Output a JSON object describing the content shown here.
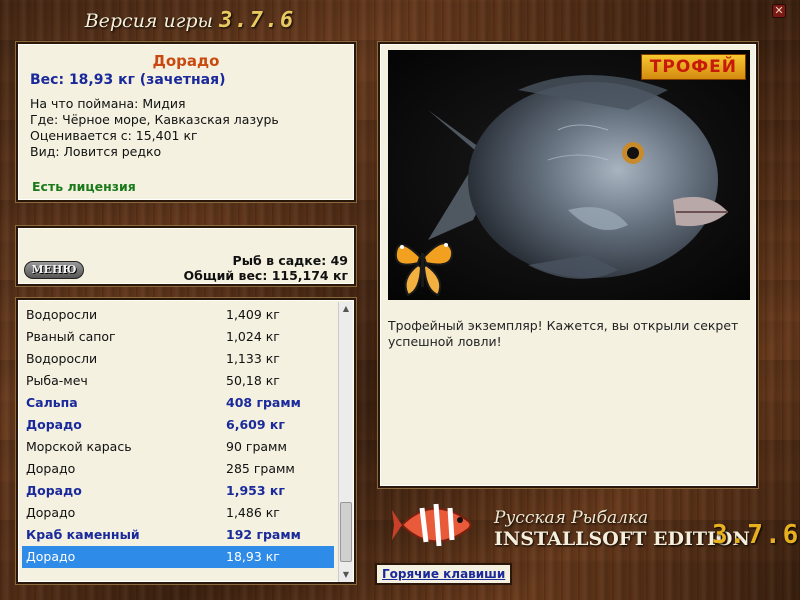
{
  "header": {
    "title": "Версия игры",
    "version": "3.7.6"
  },
  "catch_info": {
    "fish_name": "Дорадо",
    "weight_line": "Вес: 18,93 кг (зачетная)",
    "lines": [
      "На что поймана: Мидия",
      "Где: Чёрное море, Кавказская лазурь",
      "Оценивается с: 15,401 кг",
      "Вид: Ловится редко"
    ],
    "license": "Есть лицензия"
  },
  "menu": {
    "label": "МЕНЮ"
  },
  "stats": {
    "fish_in_keepnet": "Рыб в садке: 49",
    "total_weight": "Общий вес: 115,174 кг"
  },
  "catch_list": [
    {
      "name": "Водоросли",
      "weight": "1,409 кг",
      "bold": false,
      "selected": false
    },
    {
      "name": "Рваный сапог",
      "weight": "1,024 кг",
      "bold": false,
      "selected": false
    },
    {
      "name": "Водоросли",
      "weight": "1,133 кг",
      "bold": false,
      "selected": false
    },
    {
      "name": "Рыба-меч",
      "weight": "50,18 кг",
      "bold": false,
      "selected": false
    },
    {
      "name": "Сальпа",
      "weight": "408 грамм",
      "bold": true,
      "selected": false
    },
    {
      "name": "Дорадо",
      "weight": "6,609 кг",
      "bold": true,
      "selected": false
    },
    {
      "name": "Морской карась",
      "weight": "90 грамм",
      "bold": false,
      "selected": false
    },
    {
      "name": "Дорадо",
      "weight": "285 грамм",
      "bold": false,
      "selected": false
    },
    {
      "name": "Дорадо",
      "weight": "1,953 кг",
      "bold": true,
      "selected": false
    },
    {
      "name": "Дорадо",
      "weight": "1,486 кг",
      "bold": false,
      "selected": false
    },
    {
      "name": "Краб каменный",
      "weight": "192 грамм",
      "bold": true,
      "selected": false
    },
    {
      "name": "Дорадо",
      "weight": "18,93 кг",
      "bold": false,
      "selected": true
    }
  ],
  "photo": {
    "badge": "ТРОФЕЙ",
    "caption": "Трофейный экземпляр! Кажется, вы открыли секрет успешной ловли!"
  },
  "hotkeys": {
    "label": "Горячие клавиши"
  },
  "brand": {
    "title": "Русская Рыбалка",
    "edition": "INSTALLSOFT EDITION",
    "version": "3.7.6"
  },
  "colors": {
    "accent_orange": "#c84a10",
    "accent_blue": "#1a2a9a",
    "license_green": "#1a7a1a",
    "selection": "#2f8be8",
    "panel_bg": "#f5f1e1"
  }
}
